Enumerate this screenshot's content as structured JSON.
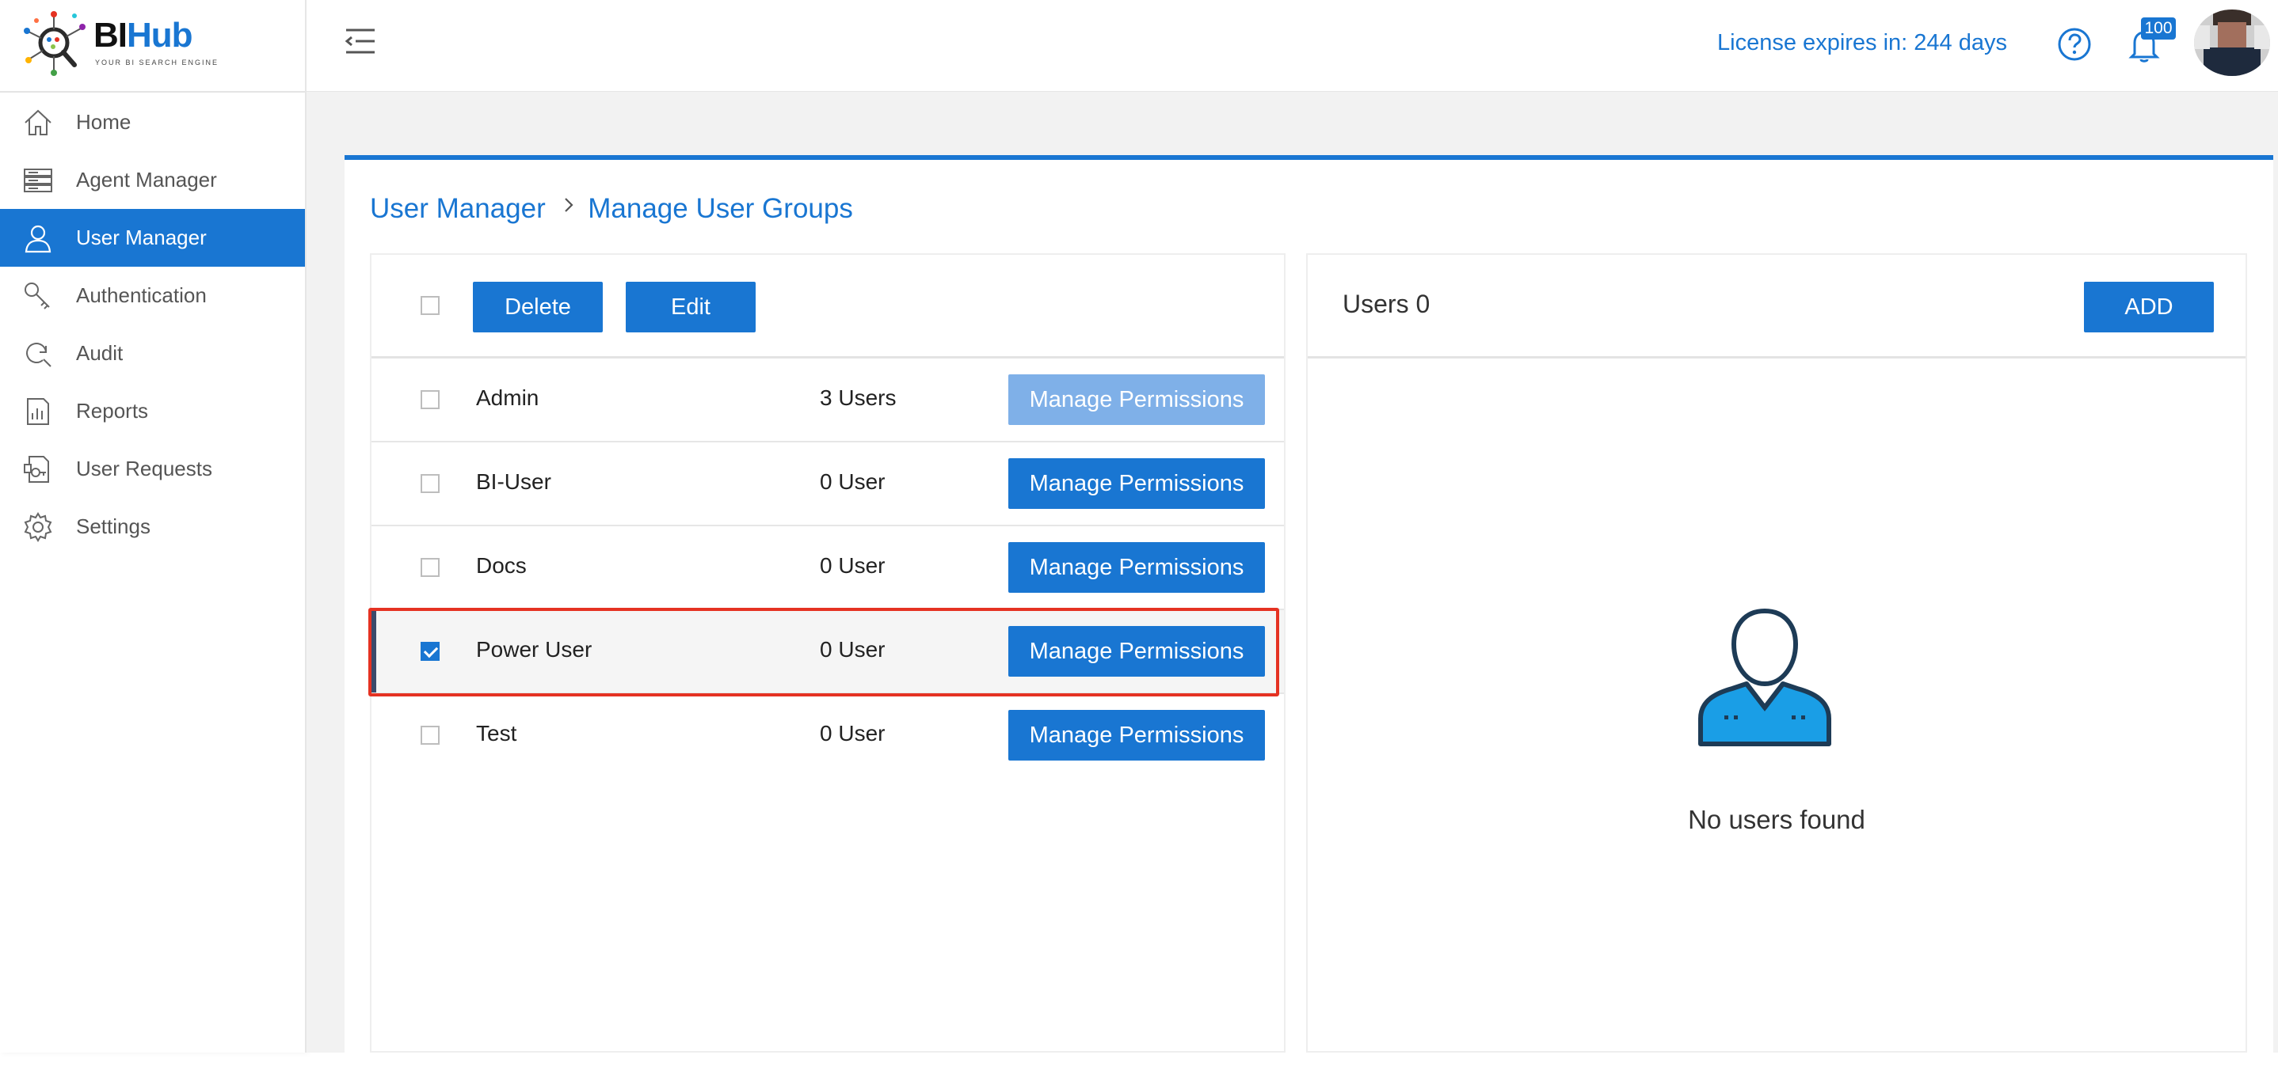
{
  "app": {
    "logo_main": "BI",
    "logo_accent": "Hub",
    "logo_tagline": "YOUR BI SEARCH ENGINE"
  },
  "sidebar": {
    "items": [
      {
        "label": "Home",
        "icon": "home-icon"
      },
      {
        "label": "Agent Manager",
        "icon": "server-icon"
      },
      {
        "label": "User Manager",
        "icon": "user-icon",
        "active": true
      },
      {
        "label": "Authentication",
        "icon": "key-icon"
      },
      {
        "label": "Audit",
        "icon": "search-refresh-icon"
      },
      {
        "label": "Reports",
        "icon": "report-chart-icon"
      },
      {
        "label": "User Requests",
        "icon": "request-document-icon"
      },
      {
        "label": "Settings",
        "icon": "gear-icon"
      }
    ]
  },
  "header": {
    "license_text": "License expires in: 244 days",
    "notification_count": "100"
  },
  "breadcrumb": {
    "parent": "User Manager",
    "current": "Manage User Groups"
  },
  "groups_panel": {
    "delete_label": "Delete",
    "edit_label": "Edit",
    "rows": [
      {
        "name": "Admin",
        "count": "3 Users",
        "button": "Manage Permissions",
        "checked": false,
        "button_disabled": true
      },
      {
        "name": "BI-User",
        "count": "0 User",
        "button": "Manage Permissions",
        "checked": false
      },
      {
        "name": "Docs",
        "count": "0 User",
        "button": "Manage Permissions",
        "checked": false
      },
      {
        "name": "Power User",
        "count": "0 User",
        "button": "Manage Permissions",
        "checked": true
      },
      {
        "name": "Test",
        "count": "0 User",
        "button": "Manage Permissions",
        "checked": false
      }
    ]
  },
  "users_panel": {
    "title": "Users 0",
    "add_label": "ADD",
    "empty_text": "No users found"
  },
  "colors": {
    "accent": "#1976d2",
    "highlight": "#e53222",
    "disabled_button": "#7fb0e8"
  }
}
